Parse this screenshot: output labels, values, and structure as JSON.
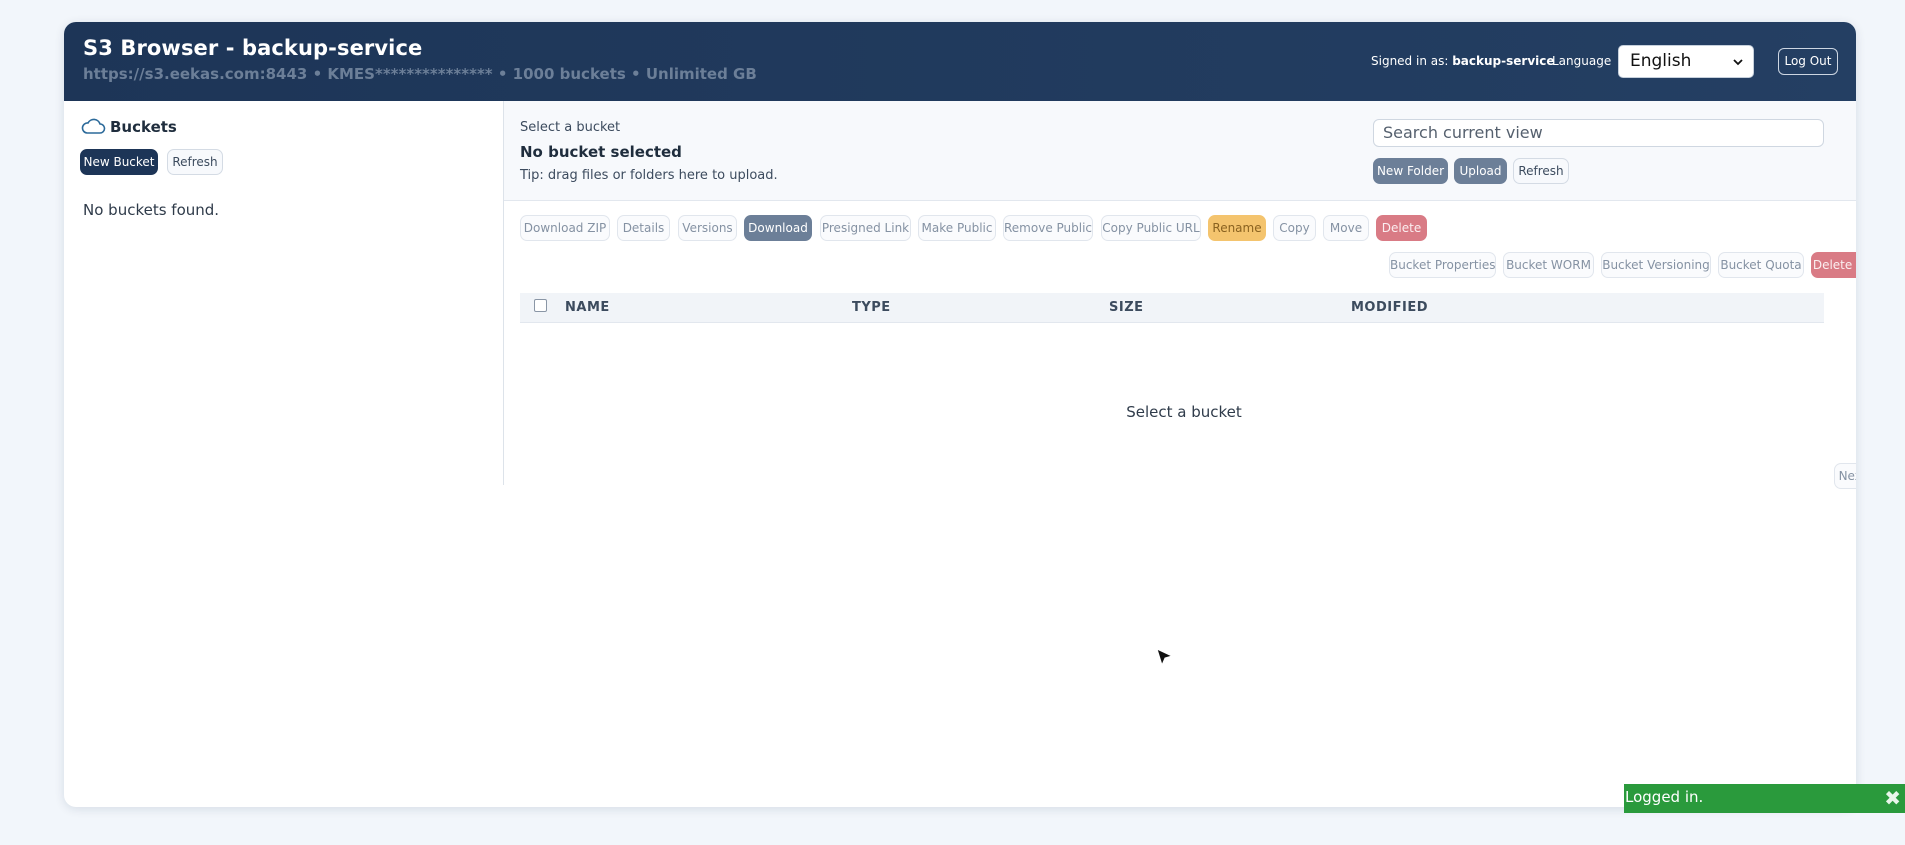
{
  "header": {
    "title": "S3 Browser - backup-service",
    "subtitle": "https://s3.eekas.com:8443 • KMES*************** • 1000 buckets • Unlimited GB",
    "signed_in_label": "Signed in as:",
    "signed_in_user": "backup-service",
    "language_label": "Language",
    "language_value": "English",
    "logout_label": "Log Out"
  },
  "sidebar": {
    "heading": "Buckets",
    "new_bucket_label": "New Bucket",
    "refresh_label": "Refresh",
    "empty_message": "No buckets found."
  },
  "main": {
    "breadcrumb": "Select a bucket",
    "bucket_title": "No bucket selected",
    "tip": "Tip: drag files or folders here to upload.",
    "search_placeholder": "Search current view",
    "new_folder_label": "New Folder",
    "upload_label": "Upload",
    "refresh_label": "Refresh",
    "actions": {
      "download_zip": "Download ZIP",
      "details": "Details",
      "versions": "Versions",
      "download": "Download",
      "presigned_link": "Presigned Link",
      "make_public": "Make Public",
      "remove_public": "Remove Public",
      "copy_public_url": "Copy Public URL",
      "rename": "Rename",
      "copy": "Copy",
      "move": "Move",
      "delete": "Delete"
    },
    "bucket_actions": {
      "properties": "Bucket Properties",
      "worm": "Bucket WORM",
      "versioning": "Bucket Versioning",
      "quota": "Bucket Quota",
      "delete": "Delete Bucket"
    },
    "table": {
      "columns": [
        "NAME",
        "TYPE",
        "SIZE",
        "MODIFIED"
      ],
      "empty_message": "Select a bucket"
    },
    "next_page_label": "Next Page"
  },
  "toast": {
    "message": "Logged in.",
    "close_symbol": "✖"
  },
  "colors": {
    "header_bg": "#1d3557",
    "accent": "#1d3557",
    "muted_button": "#6c7f98",
    "warning": "#f4c46e",
    "danger": "#d97b85",
    "toast_success": "#2a9a3c"
  }
}
